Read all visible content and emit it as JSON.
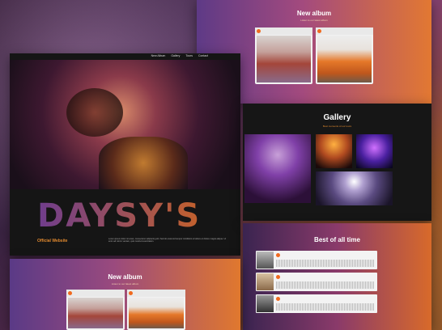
{
  "new_album_top": {
    "title": "New album",
    "subtitle": "Listen to our latest album"
  },
  "hero": {
    "nav": [
      "New Album",
      "Gallery",
      "Tours",
      "Contact"
    ],
    "brand": "DAYSY'S",
    "official": "Official Website",
    "blurb": "Lorem ipsum dolor sit amet, consectetur adipiscing elit. Sed do eiusmod tempor incididunt ut labore et dolore magna aliqua. Ut enim ad minim veniam, quis nostrud exercitation."
  },
  "gallery": {
    "title": "Gallery",
    "subtitle": "Best moments of our tours"
  },
  "best": {
    "title": "Best of all time"
  },
  "new_album_bottom": {
    "title": "New album",
    "subtitle": "Listen to our latest album"
  }
}
